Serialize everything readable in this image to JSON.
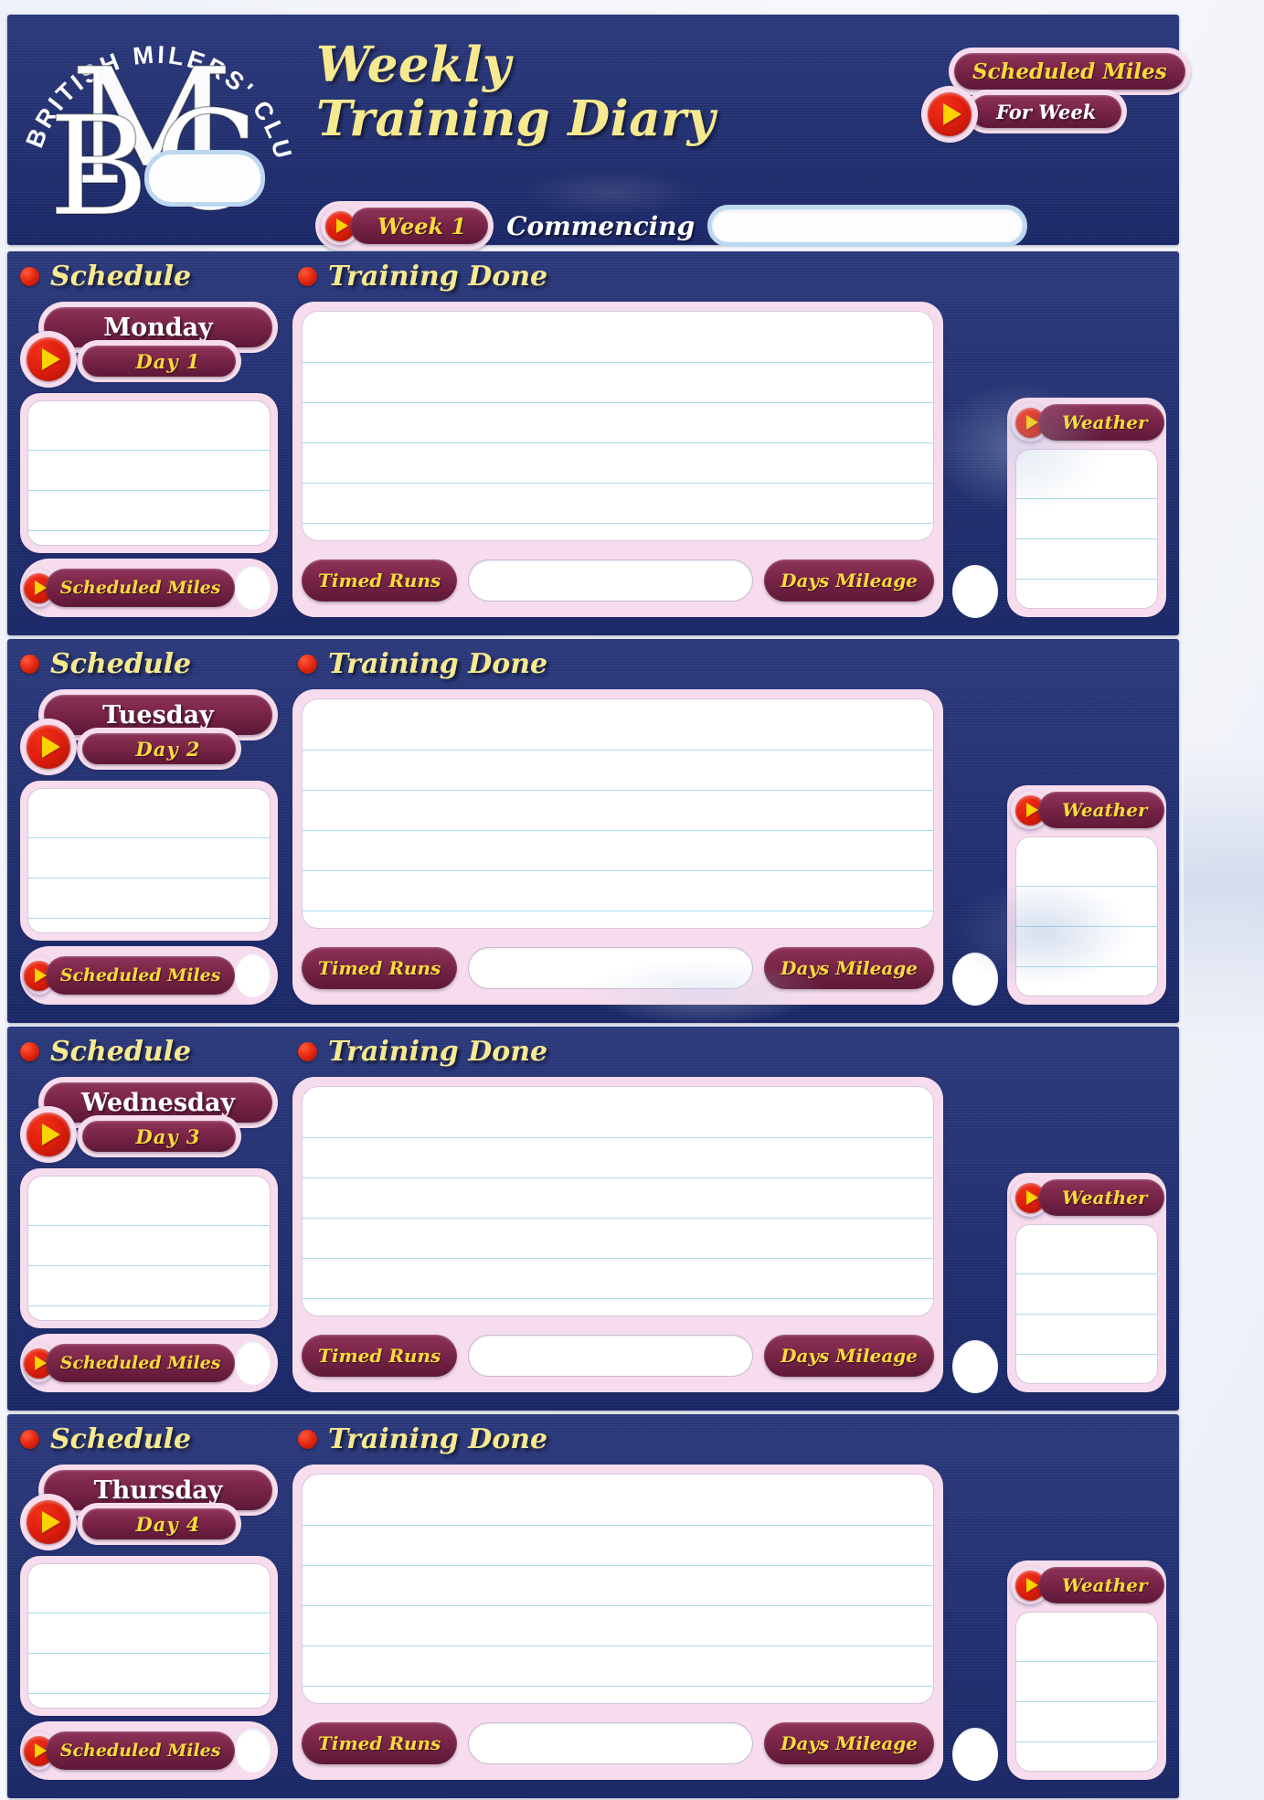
{
  "header": {
    "logo": {
      "arc_text": "BRITISH MILERS' CLUB",
      "monogram": "BMC",
      "icon_name": "bmc-club-logo"
    },
    "title_line1": "Weekly",
    "title_line2": "Training Diary",
    "week_pill": "Week 1",
    "commencing_label": "Commencing",
    "commencing_value": "",
    "commencing_placeholder": "",
    "scheduled_miles_label": "Scheduled  Miles",
    "for_week_label": "For Week",
    "week_miles_value": ""
  },
  "section_headings": {
    "schedule": "Schedule",
    "training_done": "Training Done"
  },
  "labels": {
    "scheduled_miles": "Scheduled Miles",
    "timed_runs": "Timed Runs",
    "days_mileage": "Days Mileage",
    "weather": "Weather"
  },
  "colors": {
    "navy": "#1e2d73",
    "pink_frame": "#f6dced",
    "maroon": "#7a2548",
    "yellow_text": "#fcd93b",
    "cream_title": "#f7e98f",
    "red_button": "#de1d0c",
    "rule_line": "#a8dbe8",
    "input_border": "#bcd8f0"
  },
  "days": [
    {
      "name": "Monday",
      "day_number": "Day 1",
      "schedule_text": "",
      "scheduled_miles_value": "",
      "training_done_text": "",
      "timed_runs_value": "",
      "days_mileage_value": "",
      "weather_text": ""
    },
    {
      "name": "Tuesday",
      "day_number": "Day 2",
      "schedule_text": "",
      "scheduled_miles_value": "",
      "training_done_text": "",
      "timed_runs_value": "",
      "days_mileage_value": "",
      "weather_text": ""
    },
    {
      "name": "Wednesday",
      "day_number": "Day 3",
      "schedule_text": "",
      "scheduled_miles_value": "",
      "training_done_text": "",
      "timed_runs_value": "",
      "days_mileage_value": "",
      "weather_text": ""
    },
    {
      "name": "Thursday",
      "day_number": "Day 4",
      "schedule_text": "",
      "scheduled_miles_value": "",
      "training_done_text": "",
      "timed_runs_value": "",
      "days_mileage_value": "",
      "weather_text": ""
    }
  ]
}
